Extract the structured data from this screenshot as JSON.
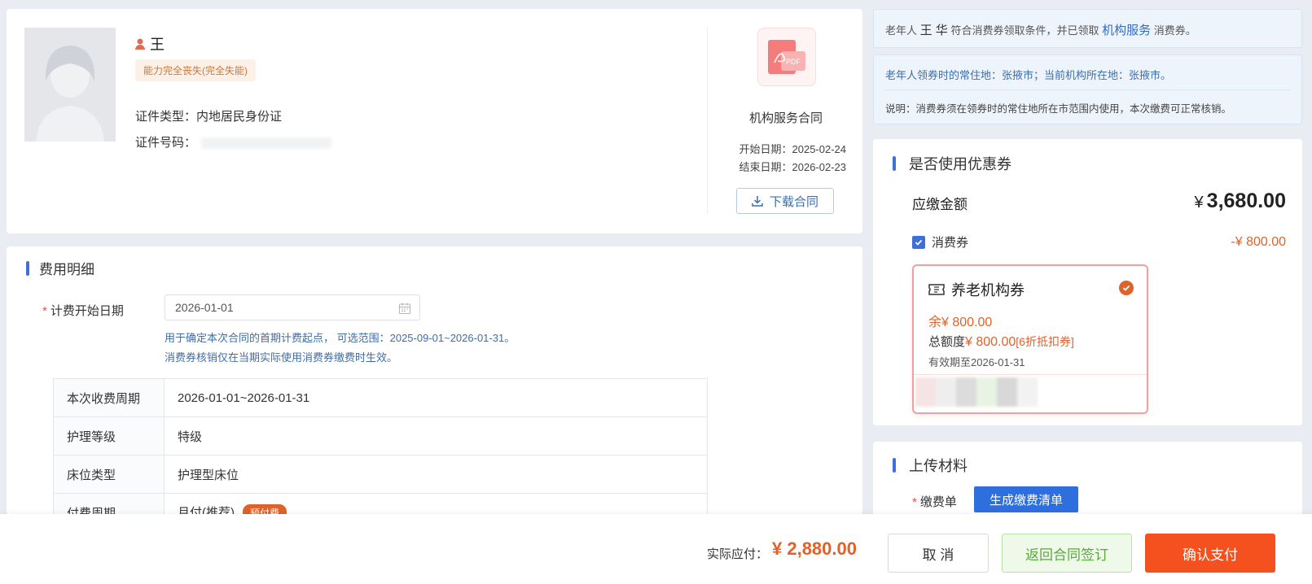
{
  "profile": {
    "name": "王",
    "ability_tag": "能力完全丧失(完全失能)",
    "id_type_label": "证件类型：",
    "id_type_value": "内地居民身份证",
    "id_no_label": "证件号码："
  },
  "contract": {
    "title": "机构服务合同",
    "start_label": "开始日期：",
    "start_date": "2025-02-24",
    "end_label": "结束日期：",
    "end_date": "2026-02-23",
    "download_label": "下载合同",
    "pdf_text": "PDF"
  },
  "fee": {
    "section_title": "费用明细",
    "start_date_label": "计费开始日期",
    "start_date_value": "2026-01-01",
    "hint1": "用于确定本次合同的首期计费起点， 可选范围：2025-09-01~2026-01-31。",
    "hint2": "消费券核销仅在当期实际使用消费券缴费时生效。",
    "rows": [
      {
        "k": "本次收费周期",
        "v": "2026-01-01~2026-01-31"
      },
      {
        "k": "护理等级",
        "v": "特级"
      },
      {
        "k": "床位类型",
        "v": "护理型床位"
      },
      {
        "k": "付费周期",
        "v": "月付(推荐)",
        "tag": "预付费"
      }
    ]
  },
  "notice": {
    "prefix": "老年人",
    "name": "王  华",
    "mid": "符合消费券领取条件，并已领取",
    "link": "机构服务",
    "suffix": "消费券。",
    "residence": "老年人领券时的常住地：张掖市；当前机构所在地：张掖市。",
    "explain": "说明：消费券须在领券时的常住地所在市范围内使用，本次缴费可正常核销。"
  },
  "coupon": {
    "section_title": "是否使用优惠券",
    "due_label": "应缴金额",
    "currency": "¥",
    "due_amount": "3,680.00",
    "voucher_label": "消费券",
    "discount": "-¥ 800.00",
    "card": {
      "title": "养老机构券",
      "balance": "余¥ 800.00",
      "total_label": "总额度",
      "total_amount": "¥ 800.00",
      "total_tag": "[6折抵扣券]",
      "valid": "有效期至2026-01-31"
    }
  },
  "upload": {
    "section_title": "上传材料",
    "bill_label": "缴费单",
    "gen_button": "生成缴费清单"
  },
  "footer": {
    "pay_label": "实际应付：",
    "pay_amount": "¥ 2,880.00",
    "cancel": "取 消",
    "back": "返回合同签订",
    "confirm": "确认支付"
  },
  "colors": {
    "accent": "#3f6fd8",
    "orange": "#e0622b",
    "confirm": "#f4511e"
  }
}
